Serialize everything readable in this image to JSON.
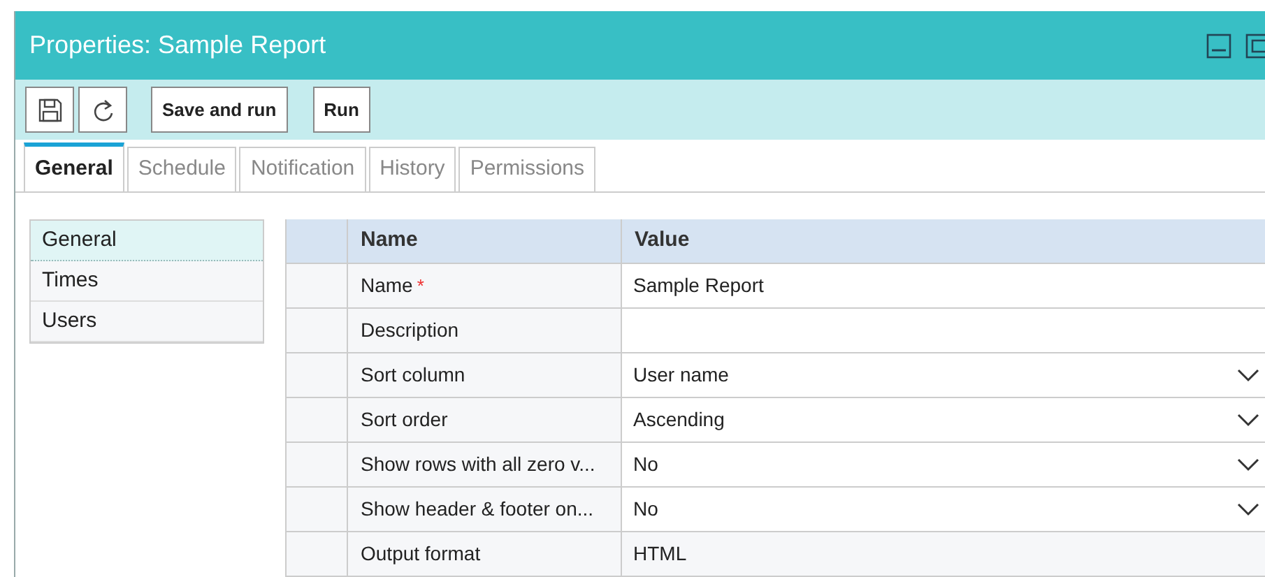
{
  "window": {
    "title": "Properties: Sample Report"
  },
  "toolbar": {
    "buttons": [
      {
        "label": "Save and run"
      },
      {
        "label": "Run"
      }
    ]
  },
  "tabs": [
    {
      "label": "General",
      "selected": true
    },
    {
      "label": "Schedule",
      "selected": false
    },
    {
      "label": "Notification",
      "selected": false
    },
    {
      "label": "History",
      "selected": false
    },
    {
      "label": "Permissions",
      "selected": false
    }
  ],
  "sections": [
    {
      "label": "General",
      "selected": true
    },
    {
      "label": "Times",
      "selected": false
    },
    {
      "label": "Users",
      "selected": false
    }
  ],
  "table": {
    "columns": [
      "Name",
      "Value"
    ],
    "rows": [
      {
        "name": "Name",
        "required_mark": "*",
        "value": "Sample Report",
        "kind": "text"
      },
      {
        "name": "Description",
        "value": "",
        "kind": "text"
      },
      {
        "name": "Sort column",
        "value": "User name",
        "kind": "dropdown"
      },
      {
        "name": "Sort order",
        "value": "Ascending",
        "kind": "dropdown"
      },
      {
        "name": "Show rows with all zero v...",
        "value": "No",
        "kind": "dropdown"
      },
      {
        "name": "Show header & footer on...",
        "value": "No",
        "kind": "dropdown"
      },
      {
        "name": "Output format",
        "value": "HTML",
        "kind": "text"
      }
    ]
  }
}
